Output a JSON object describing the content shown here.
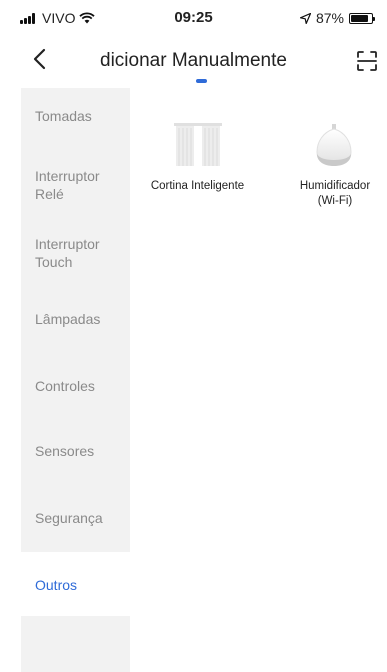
{
  "status": {
    "carrier": "VIVO",
    "time": "09:25",
    "battery": "87%"
  },
  "header": {
    "title": "dicionar Manualmente"
  },
  "categories": [
    {
      "label": "Tomadas"
    },
    {
      "label": "Interruptor\nRelé"
    },
    {
      "label": "Interruptor\nTouch"
    },
    {
      "label": "Lâmpadas"
    },
    {
      "label": "Controles"
    },
    {
      "label": "Sensores"
    },
    {
      "label": "Segurança"
    },
    {
      "label": "Outros",
      "active": true
    }
  ],
  "devices": [
    {
      "label": "Cortina Inteligente",
      "icon": "curtain-icon"
    },
    {
      "label": "Humidificador\n(Wi-Fi)",
      "icon": "humidifier-icon"
    }
  ],
  "colors": {
    "accent": "#2f6bd8",
    "sidebar_bg": "#f2f2f2",
    "inactive_text": "#8a8a8a"
  }
}
